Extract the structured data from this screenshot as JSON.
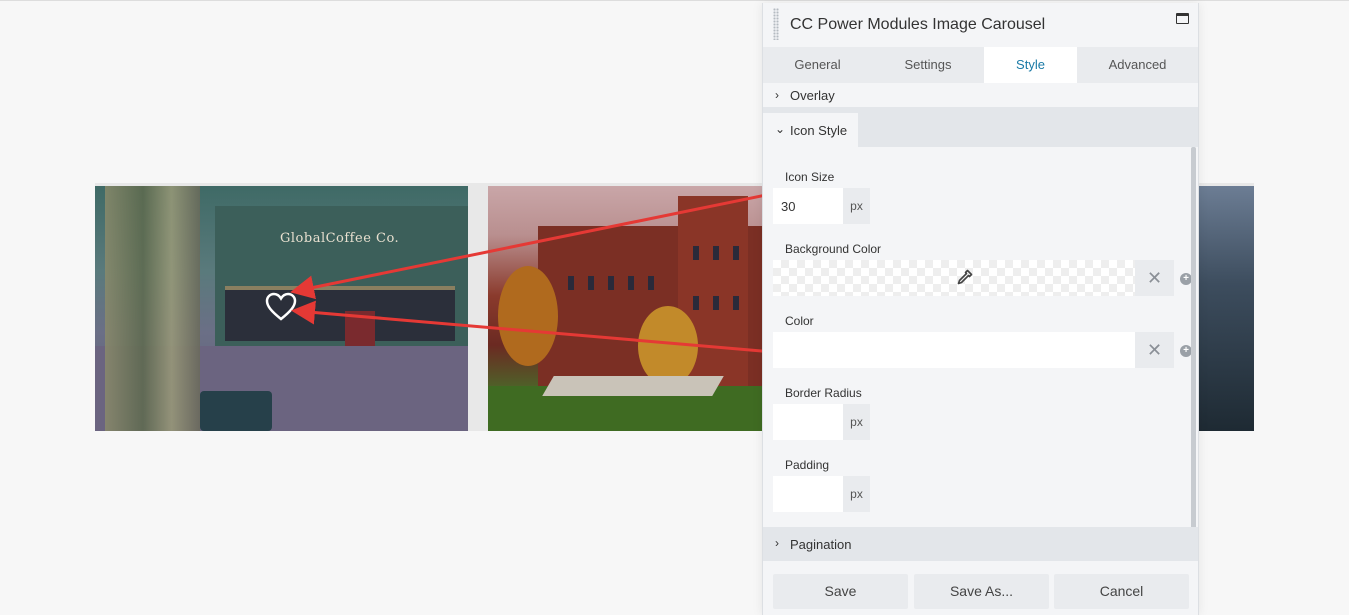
{
  "carousel": {
    "slide_1_sign": "GlobalCoffee Co."
  },
  "panel": {
    "title": "CC Power Modules Image Carousel",
    "tabs": [
      {
        "label": "General"
      },
      {
        "label": "Settings"
      },
      {
        "label": "Style",
        "active": true
      },
      {
        "label": "Advanced"
      }
    ],
    "sections": {
      "overlay": "Overlay",
      "icon_style": "Icon Style",
      "pagination": "Pagination"
    },
    "fields": {
      "icon_size": {
        "label": "Icon Size",
        "value": "30",
        "unit": "px"
      },
      "background_color": {
        "label": "Background Color"
      },
      "color": {
        "label": "Color"
      },
      "border_radius": {
        "label": "Border Radius",
        "value": "",
        "unit": "px"
      },
      "padding": {
        "label": "Padding",
        "value": "",
        "unit": "px"
      }
    },
    "buttons": {
      "save": "Save",
      "save_as": "Save As...",
      "cancel": "Cancel"
    },
    "accent_color": "#1a7aa6"
  },
  "annotation_color": "#e53935"
}
